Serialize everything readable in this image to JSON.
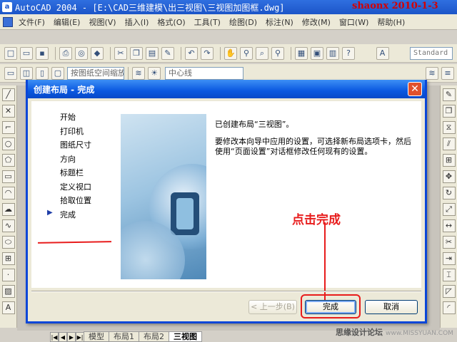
{
  "window": {
    "title": "AutoCAD 2004 - [E:\\CAD三维建模\\出三视图\\三视图加图框.dwg]",
    "app_icon": "a",
    "watermark": "shaonx 2010-1-3"
  },
  "menu": [
    "文件(F)",
    "编辑(E)",
    "视图(V)",
    "插入(I)",
    "格式(O)",
    "工具(T)",
    "绘图(D)",
    "标注(N)",
    "修改(M)",
    "窗口(W)",
    "帮助(H)"
  ],
  "toolbar": {
    "row1_icons": [
      "new-icon",
      "open-icon",
      "save-icon",
      "print-icon",
      "preview-icon",
      "publish-icon",
      "cut-icon",
      "copy-icon",
      "paste-icon",
      "matchprop-icon",
      "undo-icon",
      "redo-icon",
      "pan-icon",
      "zoom-realtime-icon",
      "zoom-window-icon",
      "zoom-previous-icon",
      "properties-icon",
      "designcenter-icon",
      "toolpalette-icon",
      "help-icon"
    ],
    "style_label": "Standard",
    "scale_combo": "按图纸空间缩放",
    "layer_combo": "中心线"
  },
  "layout_tabs": [
    "模型",
    "布局1",
    "布局2",
    "三视图"
  ],
  "active_layout_tab": "三视图",
  "watermark_bottom": "思缘设计论坛",
  "watermark_bottom_url": "www.MISSYUAN.COM",
  "dialog": {
    "title": "创建布局 - 完成",
    "steps": [
      "开始",
      "打印机",
      "图纸尺寸",
      "方向",
      "标题栏",
      "定义视口",
      "拾取位置",
      "完成"
    ],
    "current_step": "完成",
    "message_line1": "已创建布局“三视图”。",
    "message_line2": "要修改本向导中应用的设置，可选择新布局选项卡，然后使用“页面设置”对话框修改任何现有的设置。",
    "annotation": "点击完成",
    "back_button": "< 上一步(B)",
    "finish_button": "完成",
    "cancel_button": "取消"
  },
  "colors": {
    "dialog_title_blue": "#0a58e0",
    "annotation_red": "#e81c1c",
    "watermark_red": "#d40000"
  }
}
